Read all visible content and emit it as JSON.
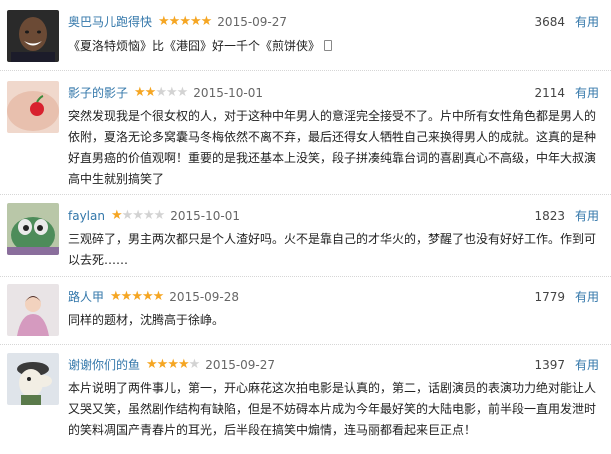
{
  "reviews": [
    {
      "username": "奥巴马儿跑得快",
      "rating": 5,
      "date": "2015-09-27",
      "votes": "3684",
      "useful_label": "有用",
      "text": "《夏洛特烦恼》比《港囧》好一千个《煎饼侠》",
      "has_phone_icon": true
    },
    {
      "username": "影子的影子",
      "rating": 2,
      "date": "2015-10-01",
      "votes": "2114",
      "useful_label": "有用",
      "text": "突然发现我是个很女权的人，对于这种中年男人的意淫完全接受不了。片中所有女性角色都是男人的依附，夏洛无论多窝囊马冬梅依然不离不弃，最后还得女人牺牲自己来换得男人的成就。这真的是种好直男癌的价值观啊！重要的是我还基本上没笑，段子拼凑纯靠台词的喜剧真心不高级，中年大叔演高中生就别搞笑了"
    },
    {
      "username": "faylan",
      "rating": 1,
      "date": "2015-10-01",
      "votes": "1823",
      "useful_label": "有用",
      "text": "三观碎了，男主两次都只是个人渣好吗。火不是靠自己的才华火的，梦醒了也没有好好工作。作到可以去死……"
    },
    {
      "username": "路人甲",
      "rating": 5,
      "date": "2015-09-28",
      "votes": "1779",
      "useful_label": "有用",
      "text": "同样的题材，沈腾高于徐峥。"
    },
    {
      "username": "谢谢你们的鱼",
      "rating": 4,
      "date": "2015-09-27",
      "votes": "1397",
      "useful_label": "有用",
      "text": "本片说明了两件事儿，第一，开心麻花这次拍电影是认真的，第二，话剧演员的表演功力绝对能让人又哭又笑，虽然剧作结构有缺陷，但是不妨碍本片成为今年最好笑的大陆电影，前半段一直用发泄时的笑料凋国产青春片的耳光，后半段在搞笑中煽情，连马丽都看起来巨正点！"
    }
  ]
}
